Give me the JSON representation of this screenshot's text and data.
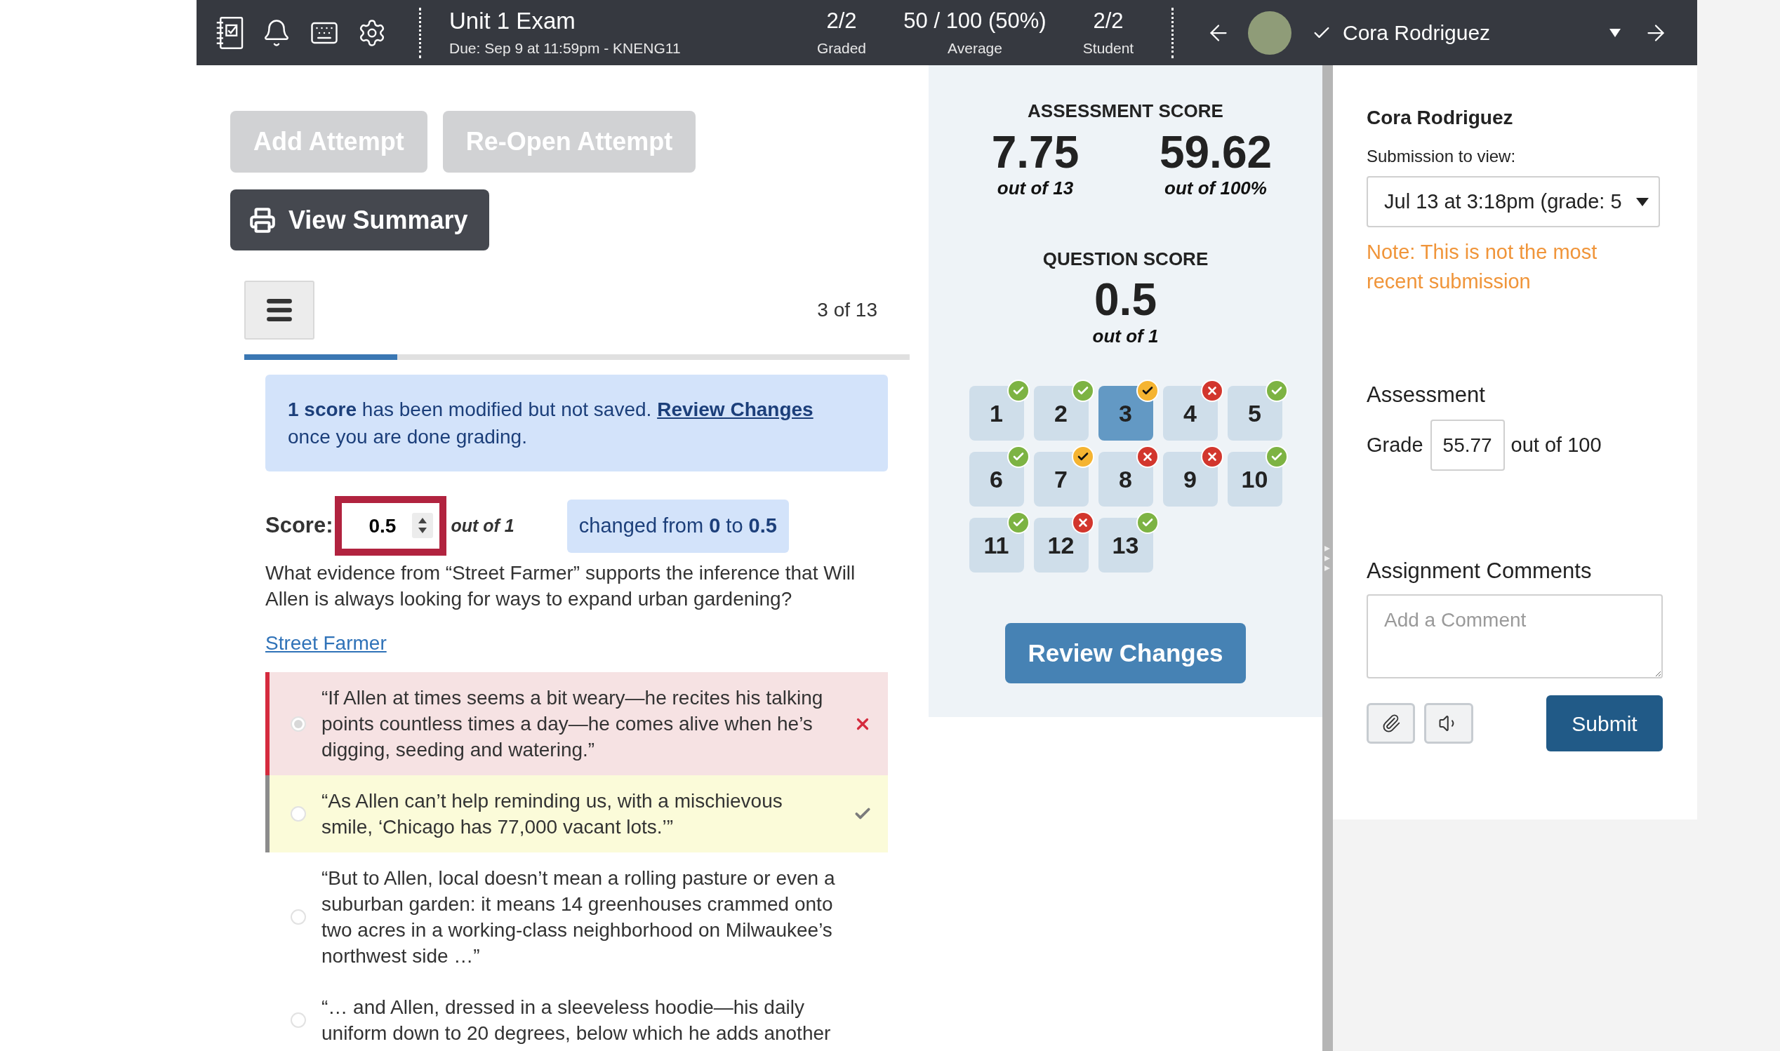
{
  "header": {
    "title": "Unit 1 Exam",
    "due": "Due: Sep 9 at 11:59pm - KNENG11",
    "stats": [
      {
        "value": "2/2",
        "label": "Graded"
      },
      {
        "value": "50 / 100 (50%)",
        "label": "Average"
      },
      {
        "value": "2/2",
        "label": "Student"
      }
    ],
    "student": {
      "name": "Cora Rodriguez",
      "graded": true
    }
  },
  "actions": [
    {
      "label": "Add Attempt",
      "disabled": true
    },
    {
      "label": "Re-Open Attempt",
      "disabled": true
    }
  ],
  "summary_button": "View Summary",
  "question_nav": {
    "position": "3 of 13",
    "progress": {
      "level": 0.23
    }
  },
  "notice": {
    "text": "**1 score** has been modified but not saved.",
    "link": "Review Changes",
    "text_after": "once you are done grading."
  },
  "score": {
    "label": "Score:",
    "value": "0.5",
    "modified": true,
    "out_of": "out of 1",
    "change": "changed from **0** to **0.5**"
  },
  "question": {
    "text": "What evidence from “Street Farmer” supports the inference that Will Allen is always looking for ways to expand urban gardening?",
    "source_link": "Street Farmer"
  },
  "choices": [
    {
      "kind": "incorrect",
      "selected": true,
      "text": "“If Allen at times seems a bit weary—he recites his talking points countless times a day—he comes alive when he’s digging, seeding and watering.”"
    },
    {
      "kind": "correct",
      "selected": false,
      "text": "“As Allen can’t help reminding us, with a mischievous smile, ‘Chicago has 77,000 vacant lots.’”"
    },
    {
      "kind": "plain",
      "selected": false,
      "text": "“But to Allen, local doesn’t mean a rolling pasture or even a suburban garden: it means 14 greenhouses crammed onto two acres in a working-class neighborhood on Milwaukee’s northwest side …”"
    },
    {
      "kind": "plain",
      "selected": false,
      "text": "“… and Allen, dressed in a sleeveless hoodie—his daily uniform down to 20 degrees, below which he adds another"
    }
  ],
  "assessment_score": {
    "title": "ASSESSMENT SCORE",
    "points": "7.75",
    "points_caption": "out of 13",
    "percent": "59.62",
    "percent_caption": "out of 100%"
  },
  "question_score": {
    "title": "QUESTION SCORE",
    "value": "0.5",
    "caption": "out of 1"
  },
  "questions": [
    {
      "number": "1",
      "kind": "correct",
      "selected": false
    },
    {
      "number": "2",
      "kind": "correct",
      "selected": false
    },
    {
      "number": "3",
      "kind": "partial",
      "selected": true
    },
    {
      "number": "4",
      "kind": "incorrect",
      "selected": false
    },
    {
      "number": "5",
      "kind": "correct",
      "selected": false
    },
    {
      "number": "6",
      "kind": "correct",
      "selected": false
    },
    {
      "number": "7",
      "kind": "partial",
      "selected": false
    },
    {
      "number": "8",
      "kind": "incorrect",
      "selected": false
    },
    {
      "number": "9",
      "kind": "incorrect",
      "selected": false
    },
    {
      "number": "10",
      "kind": "correct",
      "selected": false
    },
    {
      "number": "11",
      "kind": "correct",
      "selected": false
    },
    {
      "number": "12",
      "kind": "incorrect",
      "selected": false
    },
    {
      "number": "13",
      "kind": "correct",
      "selected": false
    }
  ],
  "review_button": "Review Changes",
  "grading": {
    "student_name": "Cora Rodriguez",
    "submission_label": "Submission to view:",
    "submission_value": "Jul 13 at 3:18pm (grade: 5",
    "note": "Note: This is not the most recent submission",
    "assessment_heading": "Assessment",
    "grade_label": "Grade",
    "grade_value": "55.77",
    "grade_out_of": "out of 100",
    "comments_heading": "Assignment Comments",
    "comment_placeholder": "Add a Comment",
    "submit": "Submit"
  }
}
